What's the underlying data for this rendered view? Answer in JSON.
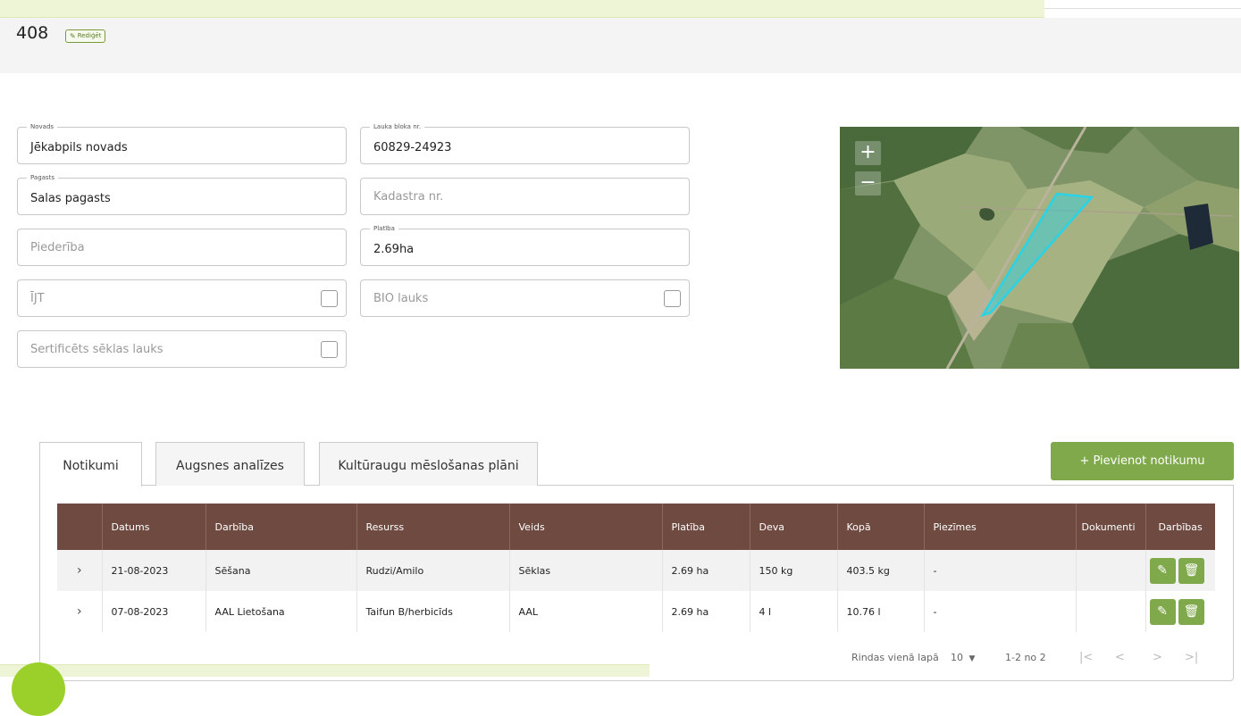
{
  "header": {
    "title": "408",
    "edit_label": "Rediģēt"
  },
  "form": {
    "novads": {
      "label": "Novads",
      "value": "Jēkabpils novads"
    },
    "lauka_bloks": {
      "label": "Lauka bloka nr.",
      "value": "60829-24923"
    },
    "pagasts": {
      "label": "Pagasts",
      "value": "Salas pagasts"
    },
    "kadastrs": {
      "placeholder": "Kadastra nr."
    },
    "piederiba": {
      "placeholder": "Piederība"
    },
    "platiba": {
      "label": "Platība",
      "value": "2.69ha"
    },
    "ijt": {
      "placeholder": "ĪJT"
    },
    "bio": {
      "placeholder": "BIO lauks"
    },
    "sertificets": {
      "placeholder": "Sertificēts sēklas lauks"
    }
  },
  "map": {
    "zoom_in": "+",
    "zoom_out": "−"
  },
  "tabs": [
    {
      "label": "Notikumi"
    },
    {
      "label": "Augsnes analīzes"
    },
    {
      "label": "Kultūraugu mēslošanas plāni"
    }
  ],
  "add_button": "+ Pievienot notikumu",
  "table": {
    "headers": [
      "Datums",
      "Darbība",
      "Resurss",
      "Veids",
      "Platība",
      "Deva",
      "Kopā",
      "Piezīmes",
      "Dokumenti",
      "Darbības"
    ],
    "rows": [
      [
        "21-08-2023",
        "Sēšana",
        "Rudzi/Amilo",
        "Sēklas",
        "2.69 ha",
        "150 kg",
        "403.5 kg",
        "-",
        ""
      ],
      [
        "07-08-2023",
        "AAL Lietošana",
        "Taifun B/herbicīds",
        "AAL",
        "2.69 ha",
        "4 l",
        "10.76 l",
        "-",
        ""
      ]
    ]
  },
  "pagination": {
    "rows_label": "Rindas vienā lapā",
    "rows_value": "10",
    "range": "1-2 no 2"
  },
  "colors": {
    "accent": "#7fa94a",
    "table_header": "#6e4a40",
    "polygon": "#29d3e6"
  },
  "icons": {
    "edit": "pencil-icon",
    "delete": "trash-icon",
    "expand": "chevron-right-icon"
  }
}
